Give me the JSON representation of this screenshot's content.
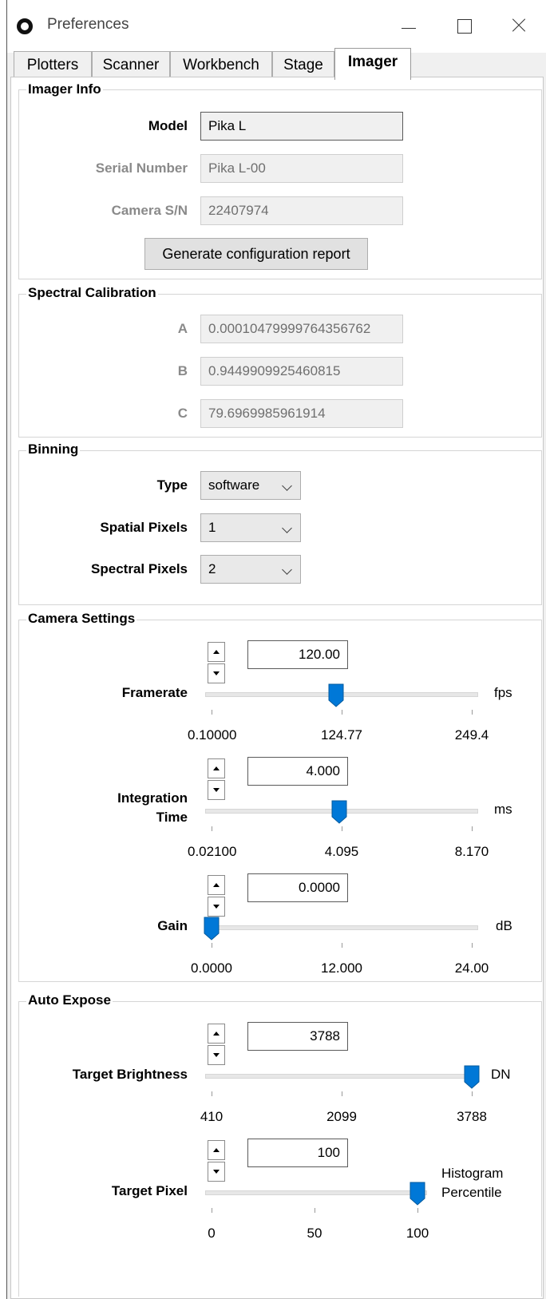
{
  "window": {
    "title": "Preferences"
  },
  "tabs": [
    {
      "label": "Plotters"
    },
    {
      "label": "Scanner"
    },
    {
      "label": "Workbench"
    },
    {
      "label": "Stage"
    },
    {
      "label": "Imager",
      "active": true
    }
  ],
  "imager_info": {
    "title": "Imager Info",
    "model_label": "Model",
    "model_value": "Pika L",
    "serial_label": "Serial Number",
    "serial_value": "Pika L-00",
    "camera_sn_label": "Camera S/N",
    "camera_sn_value": "22407974",
    "report_button": "Generate configuration report"
  },
  "spectral_calibration": {
    "title": "Spectral Calibration",
    "a_label": "A",
    "a_value": "0.00010479999764356762",
    "b_label": "B",
    "b_value": "0.9449909925460815",
    "c_label": "C",
    "c_value": "79.6969985961914"
  },
  "binning": {
    "title": "Binning",
    "type_label": "Type",
    "type_value": "software",
    "spatial_label": "Spatial Pixels",
    "spatial_value": "1",
    "spectral_label": "Spectral Pixels",
    "spectral_value": "2"
  },
  "camera_settings": {
    "title": "Camera Settings",
    "framerate": {
      "label": "Framerate",
      "value": "120.00",
      "unit": "fps",
      "slider_fraction": 0.48,
      "ticks": [
        "0.10000",
        "124.77",
        "249.4"
      ]
    },
    "integration": {
      "label_line1": "Integration",
      "label_line2": "Time",
      "value": "4.000",
      "unit": "ms",
      "slider_fraction": 0.49,
      "ticks": [
        "0.02100",
        "4.095",
        "8.170"
      ]
    },
    "gain": {
      "label": "Gain",
      "value": "0.0000",
      "unit": "dB",
      "slider_fraction": 0.0,
      "ticks": [
        "0.0000",
        "12.000",
        "24.00"
      ]
    }
  },
  "auto_expose": {
    "title": "Auto Expose",
    "target_brightness": {
      "label": "Target Brightness",
      "value": "3788",
      "unit": "DN",
      "slider_fraction": 1.0,
      "ticks": [
        "410",
        "2099",
        "3788"
      ]
    },
    "target_pixel": {
      "label": "Target Pixel",
      "value": "100",
      "unit_line1": "Histogram",
      "unit_line2": "Percentile",
      "slider_fraction": 1.0,
      "ticks": [
        "0",
        "50",
        "100"
      ]
    }
  },
  "colors": {
    "slider_thumb": "#0078d7",
    "accent_border": "#5a5a5a"
  }
}
